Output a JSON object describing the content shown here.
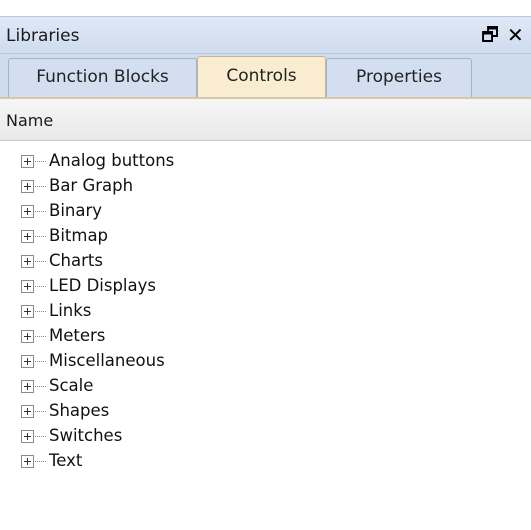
{
  "panel": {
    "title": "Libraries",
    "pin_symbol": "🗗",
    "close_symbol": "✕"
  },
  "tabs": [
    {
      "label": "Function Blocks",
      "active": false
    },
    {
      "label": "Controls",
      "active": true
    },
    {
      "label": "Properties",
      "active": false
    }
  ],
  "list": {
    "header": "Name",
    "items": [
      {
        "label": "Analog buttons"
      },
      {
        "label": "Bar Graph"
      },
      {
        "label": "Binary"
      },
      {
        "label": "Bitmap"
      },
      {
        "label": "Charts"
      },
      {
        "label": "LED Displays"
      },
      {
        "label": "Links"
      },
      {
        "label": "Meters"
      },
      {
        "label": "Miscellaneous"
      },
      {
        "label": "Scale"
      },
      {
        "label": "Shapes"
      },
      {
        "label": "Switches"
      },
      {
        "label": "Text"
      }
    ]
  },
  "colors": {
    "titlebar": "#d6e2f3",
    "active_tab": "#f9ecd0",
    "inactive_tab": "#d3dff0"
  },
  "icons": {
    "pin": "pin-icon",
    "close": "close-icon",
    "expand": "expand-plus-icon"
  }
}
